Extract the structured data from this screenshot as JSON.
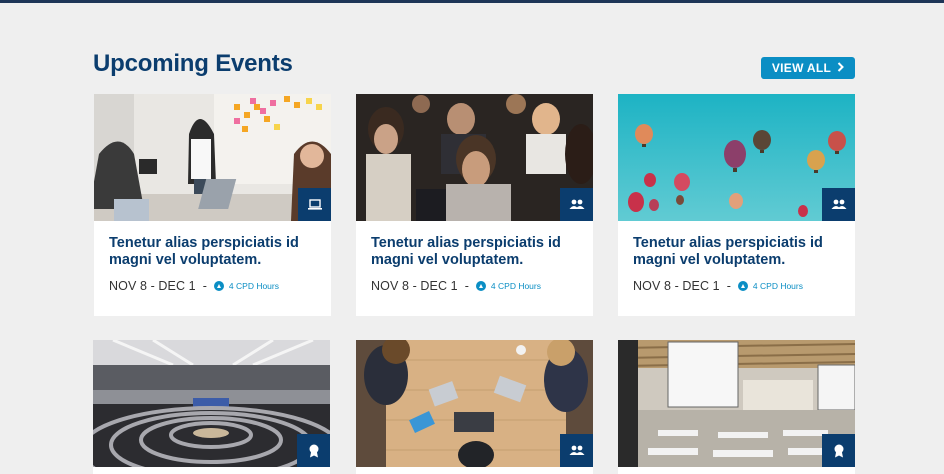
{
  "section": {
    "title": "Upcoming Events",
    "view_all_label": "VIEW ALL",
    "view_all_icon": "chevron-right-icon"
  },
  "colors": {
    "background": "#efefef",
    "title": "#0b3d6e",
    "accent": "#0b8ec4",
    "badge": "#0b3d6e"
  },
  "events": [
    {
      "title": "Tenetur alias perspiciatis id magni vel voluptatem.",
      "dates": "NOV 8 - DEC 1",
      "separator": "-",
      "cpd": "4 CPD Hours",
      "type_icon": "laptop-icon",
      "photo": "meeting-whiteboard"
    },
    {
      "title": "Tenetur alias perspiciatis id magni vel voluptatem.",
      "dates": "NOV 8 - DEC 1",
      "separator": "-",
      "cpd": "4 CPD Hours",
      "type_icon": "people-icon",
      "photo": "audience"
    },
    {
      "title": "Tenetur alias perspiciatis id magni vel voluptatem.",
      "dates": "NOV 8 - DEC 1",
      "separator": "-",
      "cpd": "4 CPD Hours",
      "type_icon": "people-icon",
      "photo": "hot-air-balloons"
    },
    {
      "title": "",
      "dates": "",
      "cpd": "",
      "type_icon": "award-icon",
      "photo": "parliament-hall"
    },
    {
      "title": "",
      "dates": "",
      "cpd": "",
      "type_icon": "people-icon",
      "photo": "laptops-table"
    },
    {
      "title": "",
      "dates": "",
      "cpd": "",
      "type_icon": "award-icon",
      "photo": "conference-room"
    }
  ]
}
